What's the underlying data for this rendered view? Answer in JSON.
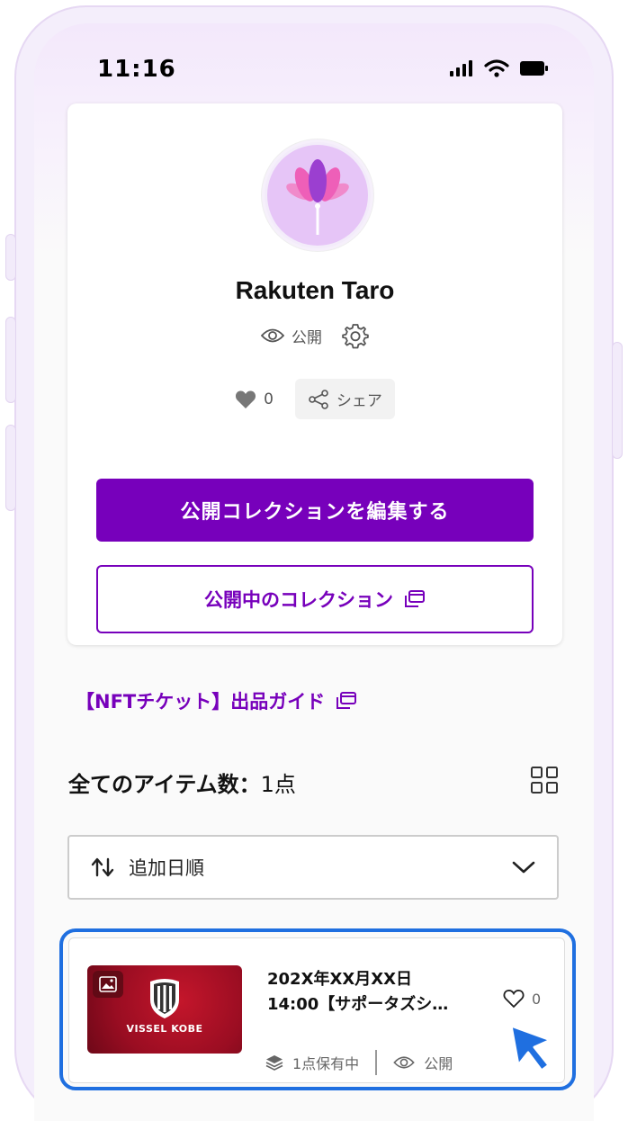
{
  "status_bar": {
    "time": "11:16"
  },
  "profile": {
    "name": "Rakuten Taro",
    "visibility": "公開",
    "like_count": "0",
    "share_label": "シェア",
    "edit_button": "公開コレクションを編集する",
    "public_collection_button": "公開中のコレクション"
  },
  "guide_link": "【NFTチケット】出品ガイド",
  "items": {
    "heading": "全てのアイテム数：",
    "count": "1点",
    "sort_value": "追加日順"
  },
  "item_card": {
    "title_line1": "202X年XX月XX日",
    "title_line2": "14:00【サポータズシ…",
    "like_count": "0",
    "owned": "1点保有中",
    "visibility": "公開",
    "thumbnail_text": "VISSEL KOBE"
  },
  "colors": {
    "accent": "#7700bb",
    "highlight": "#1f6fe0",
    "cursor": "#1f6fe0"
  }
}
